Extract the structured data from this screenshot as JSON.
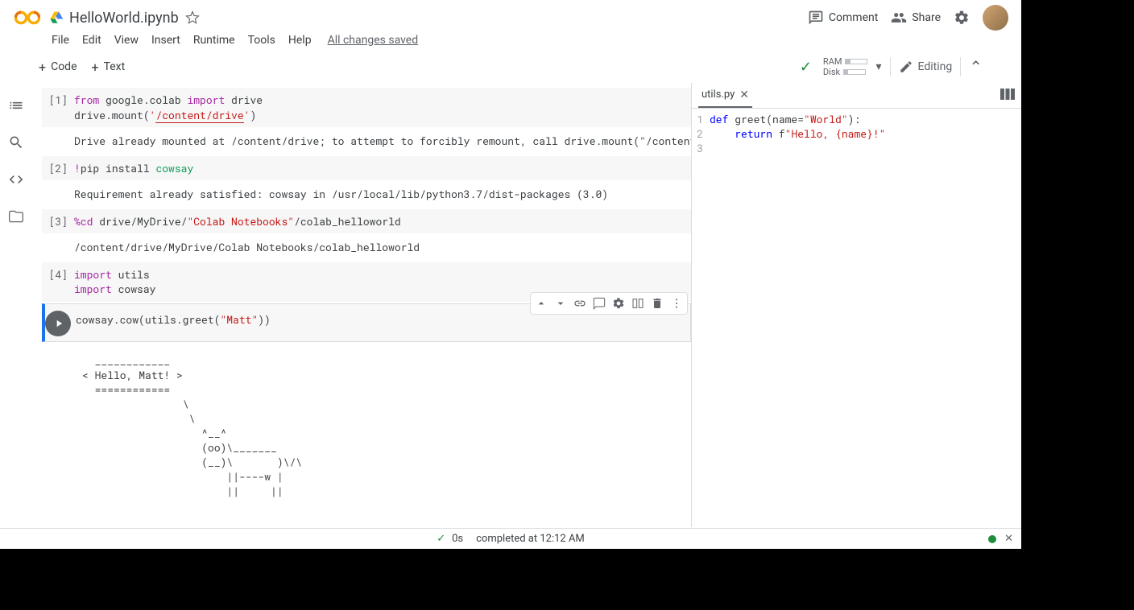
{
  "header": {
    "title": "HelloWorld.ipynb",
    "comment": "Comment",
    "share": "Share"
  },
  "menubar": {
    "file": "File",
    "edit": "Edit",
    "view": "View",
    "insert": "Insert",
    "runtime": "Runtime",
    "tools": "Tools",
    "help": "Help",
    "saved": "All changes saved"
  },
  "toolbar": {
    "code": "Code",
    "text": "Text",
    "ram": "RAM",
    "disk": "Disk",
    "editing": "Editing"
  },
  "cells": {
    "c1_prompt": "[1]",
    "c1_l1a": "from",
    "c1_l1b": " google.colab ",
    "c1_l1c": "import",
    "c1_l1d": " drive",
    "c1_l2a": "drive.mount(",
    "c1_l2b": "'",
    "c1_l2c": "/content/drive",
    "c1_l2d": "'",
    "c1_l2e": ")",
    "c1_out": "Drive already mounted at /content/drive; to attempt to forcibly remount, call drive.mount(\"/content",
    "c2_prompt": "[2]",
    "c2_l1a": "!",
    "c2_l1b": "pip install ",
    "c2_l1c": "cowsay",
    "c2_out": "Requirement already satisfied: cowsay in /usr/local/lib/python3.7/dist-packages (3.0)",
    "c3_prompt": "[3]",
    "c3_l1a": "%cd",
    "c3_l1b": " drive/MyDrive/",
    "c3_l1c": "\"Colab Notebooks\"",
    "c3_l1d": "/colab_helloworld",
    "c3_out": "/content/drive/MyDrive/Colab Notebooks/colab_helloworld",
    "c4_prompt": "[4]",
    "c4_l1a": "import",
    "c4_l1b": " utils",
    "c4_l2a": "import",
    "c4_l2b": " cowsay",
    "c5_l1a": "cowsay.cow(utils.greet(",
    "c5_l1b": "\"Matt\"",
    "c5_l1c": "))",
    "c5_out": "  ____________\n< Hello, Matt! >\n  ============\n                \\\n                 \\\n                   ^__^\n                   (oo)\\_______\n                   (__)\\       )\\/\\\n                       ||----w |\n                       ||     ||"
  },
  "editor": {
    "tab": "utils.py",
    "l1a": "def",
    "l1b": " greet(name=",
    "l1c": "\"World\"",
    "l1d": "):",
    "l2a": "    ",
    "l2b": "return",
    "l2c": " f",
    "l2d": "\"Hello, {name}!\"",
    "ln1": "1",
    "ln2": "2",
    "ln3": "3"
  },
  "status": {
    "time": "0s",
    "msg": "completed at 12:12 AM"
  }
}
